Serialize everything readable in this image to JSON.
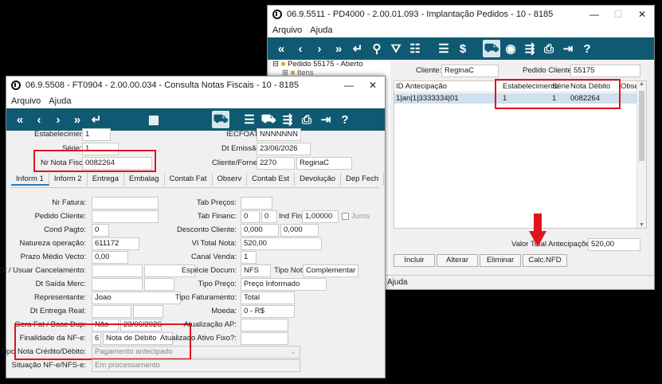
{
  "back_window": {
    "title": "06.9.5511 - PD4000 - 2.00.01.093 - Implantação Pedidos - 10 - 8185",
    "menu": [
      "Arquivo",
      "Ajuda"
    ],
    "tree": {
      "root": "Pedido 55175 - Aberto",
      "child": "Itens"
    },
    "cliente_label": "Cliente:",
    "cliente_value": "ReginaC",
    "pedido_cliente_label": "Pedido Cliente:",
    "pedido_cliente_value": "55175",
    "grid": {
      "columns": [
        "ID Antecipação",
        "Estabelecimento",
        "Série",
        "Nota Débito",
        "Obser"
      ],
      "row": [
        "1|an|1|3333334|01",
        "1",
        "1",
        "0082264",
        ""
      ]
    },
    "valor_total_label": "Valor Total Antecipações:",
    "valor_total_value": "520,00",
    "buttons": {
      "incluir": "Incluir",
      "alterar": "Alterar",
      "eliminar": "Eliminar",
      "calc": "Calc.NFD"
    },
    "status": "Ajuda"
  },
  "front_window": {
    "title": "06.9.5508 - FT0904 - 2.00.00.034 - Consulta Notas Fiscais - 10 - 8185",
    "menu": [
      "Arquivo",
      "Ajuda"
    ],
    "header": {
      "estabelecimento_label": "Estabelecimento:",
      "estabelecimento": "1",
      "serie_label": "Série:",
      "serie": "1",
      "nr_nota_label": "Nr Nota Fiscal:",
      "nr_nota": "0082264",
      "iecfoat_label": "IECFOAT:",
      "iecfoat": "NNNNNNN",
      "dt_emissao_label": "Dt Emissão:",
      "dt_emissao": "23/06/2026",
      "cliente_label": "Cliente/Fornec:",
      "cliente_code": "2270",
      "cliente_name": "ReginaC"
    },
    "tabs": [
      "Inform 1",
      "Inform 2",
      "Entrega",
      "Embalag",
      "Contab Fat",
      "Observ",
      "Contab Est",
      "Devolução",
      "Dep Fech"
    ],
    "left": {
      "nr_fatura": "Nr Fatura:",
      "pedido_cliente": "Pedido Cliente:",
      "cond_pagto": "Cond Pagto:",
      "cond_pagto_value": "0",
      "natureza": "Natureza operação:",
      "natureza_value": "611172",
      "prazo": "Prazo Médio Vecto:",
      "prazo_value": "0,00",
      "dt_usuar": "Dt / Usuar Cancelamento:",
      "dt_saida": "Dt Saída Merc:",
      "representante": "Representante:",
      "representante_value": "Joao",
      "dt_entrega": "Dt Entrega Real:",
      "gera_fat": "Gera Fat / Base Dup:",
      "gera_fat_value": "Não",
      "gera_fat_date": "23/06/2026",
      "finalidade": "Finalidade da NF-e:",
      "finalidade_code": "6",
      "finalidade_value": "Nota de Débito",
      "tipo_nota_cred": "Tipo Nota Crédito/Débito:",
      "tipo_nota_cred_value": "Pagamento antecipado",
      "situacao": "Situação NF-e/NFS-e:",
      "situacao_value": "Em processamento"
    },
    "right": {
      "tab_precos": "Tab Preços:",
      "tab_financ": "Tab Financ:",
      "tab_financ_a": "0",
      "tab_financ_b": "0",
      "ind_fin": "Ind Fin:",
      "ind_fin_value": "1,00000",
      "juros": "Juros",
      "desconto": "Desconto Cliente:",
      "desconto_a": "0,000",
      "desconto_b": "0,000",
      "vl_total": "Vl Total Nota:",
      "vl_total_value": "520,00",
      "canal": "Canal Venda:",
      "canal_value": "1",
      "especie": "Espécie Docum:",
      "especie_value": "NFS",
      "tipo_nota": "Tipo Nota:",
      "tipo_nota_value": "Complementar",
      "tipo_preco": "Tipo Preço:",
      "tipo_preco_value": "Preço Informado",
      "tipo_fat": "Tipo Faturamento:",
      "tipo_fat_value": "Total",
      "moeda": "Moeda:",
      "moeda_value": "0 - R$",
      "atualizacao": "Atualização AP:",
      "atualizado": "Atualizado Ativo Fixo?:"
    }
  },
  "colors": {
    "toolbar": "#0f5a72",
    "highlight": "#e0141e",
    "selection": "#cfe0ee"
  }
}
